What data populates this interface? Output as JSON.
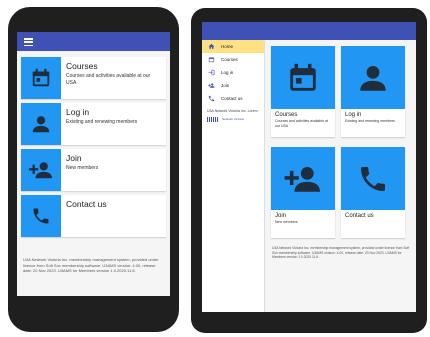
{
  "colors": {
    "appbar": "#3f51b5",
    "tile": "#2196f3",
    "active_nav": "#ffe082"
  },
  "menu": [
    {
      "title": "Courses",
      "subtitle": "Courses and activities available at our USA",
      "icon": "calendar-icon"
    },
    {
      "title": "Log in",
      "subtitle": "Existing and renewing members",
      "icon": "person-icon"
    },
    {
      "title": "Join",
      "subtitle": "New members",
      "icon": "person-add-icon"
    },
    {
      "title": "Contact us",
      "subtitle": "",
      "icon": "phone-icon"
    }
  ],
  "footer": "U3A Network Victoria Inc. membership management system, provided under licence from Soft Sox membership software. U3AMS version: 4.00, release date: 20 Nov 2023. U3AMS for Members version 1.0.2020.11.6.",
  "drawer": {
    "items": [
      {
        "label": "Home",
        "icon": "home-icon"
      },
      {
        "label": "Courses",
        "icon": "calendar-icon"
      },
      {
        "label": "Log in",
        "icon": "login-icon"
      },
      {
        "label": "Join",
        "icon": "person-add-icon"
      },
      {
        "label": "Contact us",
        "icon": "phone-icon"
      }
    ],
    "active_index": 0,
    "info": "U3A Network Victoria Inc. Lorem",
    "logo_text": "Network Victoria"
  },
  "tablet_cards": [
    {
      "title": "Courses",
      "subtitle": "Courses and activities available at our USA"
    },
    {
      "title": "Log in",
      "subtitle": "Existing and renewing members"
    },
    {
      "title": "Join",
      "subtitle": "New members"
    },
    {
      "title": "Contact us",
      "subtitle": ""
    }
  ]
}
